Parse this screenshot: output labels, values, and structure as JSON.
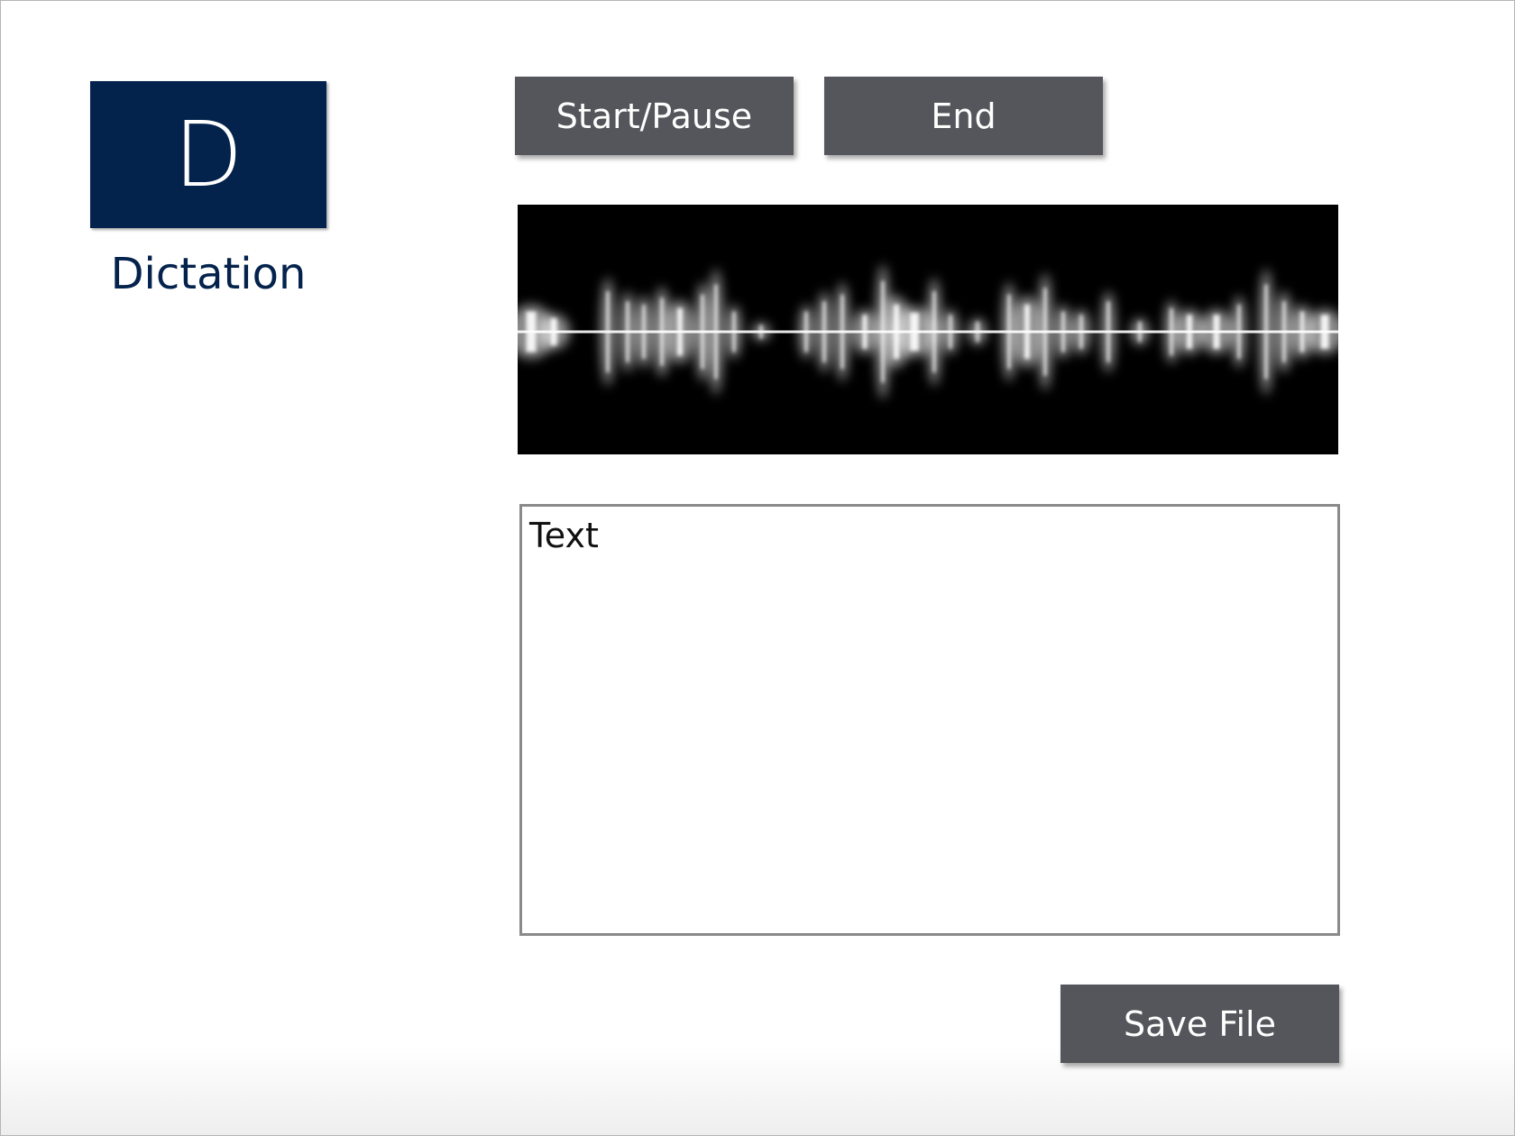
{
  "app": {
    "logo_letter": "D",
    "name": "Dictation",
    "brand_color": "#03224c"
  },
  "controls": {
    "start_pause_label": "Start/Pause",
    "end_label": "End",
    "button_color": "#54565b"
  },
  "waveform": {
    "background": "#000000",
    "wave_color": "#ffffff"
  },
  "editor": {
    "text": "Text",
    "border_color": "#8a8a8a"
  },
  "footer": {
    "save_label": "Save File"
  }
}
